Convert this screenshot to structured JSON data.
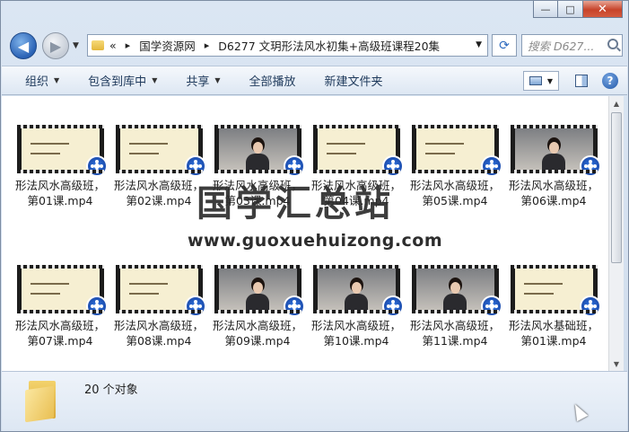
{
  "window": {
    "controls": {
      "minimize": "—",
      "maximize": "□",
      "close": "✕"
    }
  },
  "address": {
    "overflow": "«",
    "crumbs": [
      "国学资源网",
      "D6277 文玥形法风水初集+高级班课程20集"
    ],
    "search_placeholder": "搜索 D627..."
  },
  "toolbar": {
    "organize": "组织",
    "include_library": "包含到库中",
    "share": "共享",
    "play_all": "全部播放",
    "new_folder": "新建文件夹"
  },
  "files": [
    {
      "line1": "形法风水高级班，",
      "line2": "第01课.mp4",
      "thumb": "slide"
    },
    {
      "line1": "形法风水高级班，",
      "line2": "第02课.mp4",
      "thumb": "slide"
    },
    {
      "line1": "形法风水高级班，",
      "line2": "第03课.mp4",
      "thumb": "video"
    },
    {
      "line1": "形法风水高级班，",
      "line2": "第04课.mp4",
      "thumb": "slide"
    },
    {
      "line1": "形法风水高级班，",
      "line2": "第05课.mp4",
      "thumb": "slide"
    },
    {
      "line1": "形法风水高级班，",
      "line2": "第06课.mp4",
      "thumb": "video"
    },
    {
      "line1": "形法风水高级班，",
      "line2": "第07课.mp4",
      "thumb": "slide"
    },
    {
      "line1": "形法风水高级班，",
      "line2": "第08课.mp4",
      "thumb": "slide"
    },
    {
      "line1": "形法风水高级班，",
      "line2": "第09课.mp4",
      "thumb": "video"
    },
    {
      "line1": "形法风水高级班，",
      "line2": "第10课.mp4",
      "thumb": "video"
    },
    {
      "line1": "形法风水高级班，",
      "line2": "第11课.mp4",
      "thumb": "video"
    },
    {
      "line1": "形法风水基础班，",
      "line2": "第01课.mp4",
      "thumb": "slide"
    }
  ],
  "watermark": {
    "title": "国学汇总站",
    "url": "www.guoxuehuizong.com"
  },
  "details": {
    "count": "20 个对象"
  }
}
